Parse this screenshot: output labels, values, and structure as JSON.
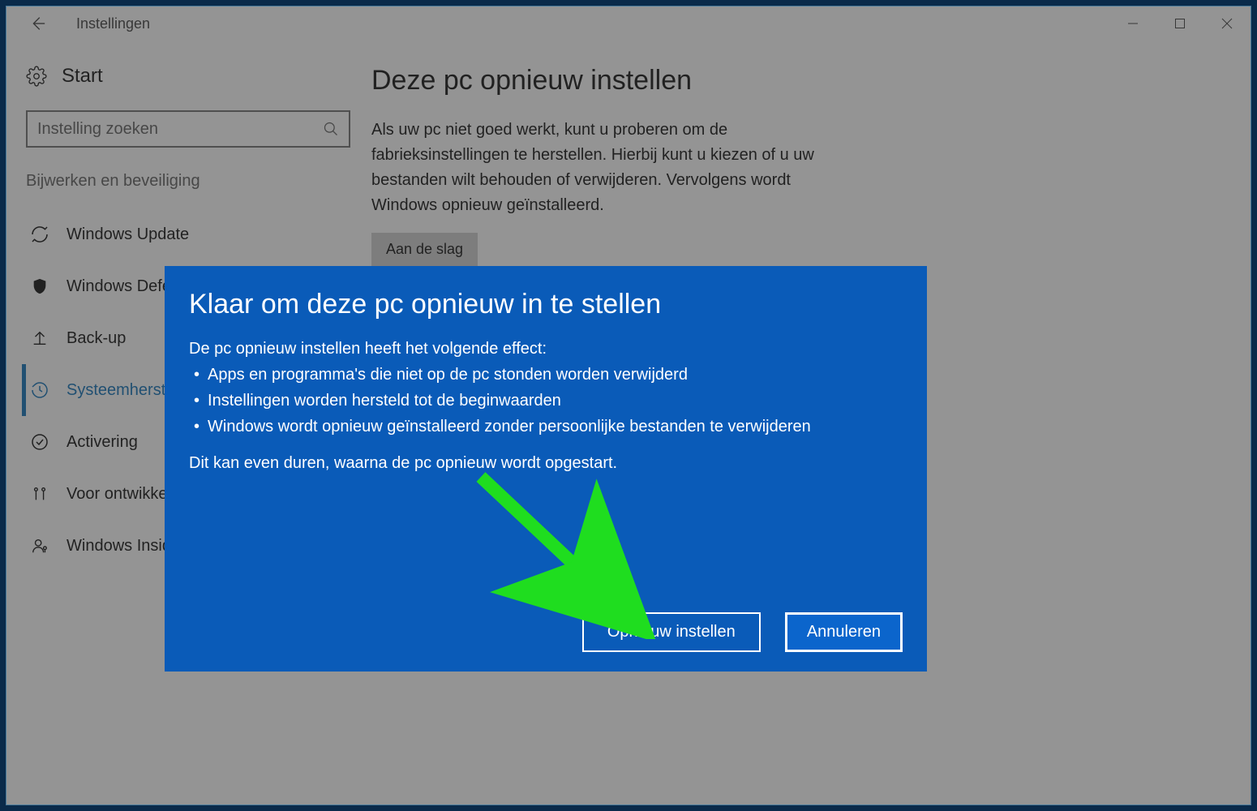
{
  "titlebar": {
    "title": "Instellingen"
  },
  "sidebar": {
    "header_label": "Start",
    "search_placeholder": "Instelling zoeken",
    "group_title": "Bijwerken en beveiliging",
    "items": [
      {
        "label": "Windows Update",
        "icon": "sync"
      },
      {
        "label": "Windows Defender",
        "icon": "shield"
      },
      {
        "label": "Back-up",
        "icon": "backup"
      },
      {
        "label": "Systeemherstel",
        "icon": "history",
        "active": true
      },
      {
        "label": "Activering",
        "icon": "check"
      },
      {
        "label": "Voor ontwikkelaars",
        "icon": "dev"
      },
      {
        "label": "Windows Insider-programma",
        "icon": "insider"
      }
    ]
  },
  "main": {
    "heading": "Deze pc opnieuw instellen",
    "description": "Als uw pc niet goed werkt, kunt u proberen om de fabrieksinstellingen te herstellen. Hierbij kunt u kiezen of u uw bestanden wilt behouden of verwijderen. Vervolgens wordt Windows opnieuw geïnstalleerd.",
    "start_button": "Aan de slag"
  },
  "modal": {
    "title": "Klaar om deze pc opnieuw in te stellen",
    "intro": "De pc opnieuw instellen heeft het volgende effect:",
    "bullets": [
      "Apps en programma's die niet op de pc stonden worden verwijderd",
      "Instellingen worden hersteld tot de beginwaarden",
      "Windows wordt opnieuw geïnstalleerd zonder persoonlijke bestanden te verwijderen"
    ],
    "note": "Dit kan even duren, waarna de pc opnieuw wordt opgestart.",
    "primary_button": "Opnieuw instellen",
    "secondary_button": "Annuleren"
  }
}
